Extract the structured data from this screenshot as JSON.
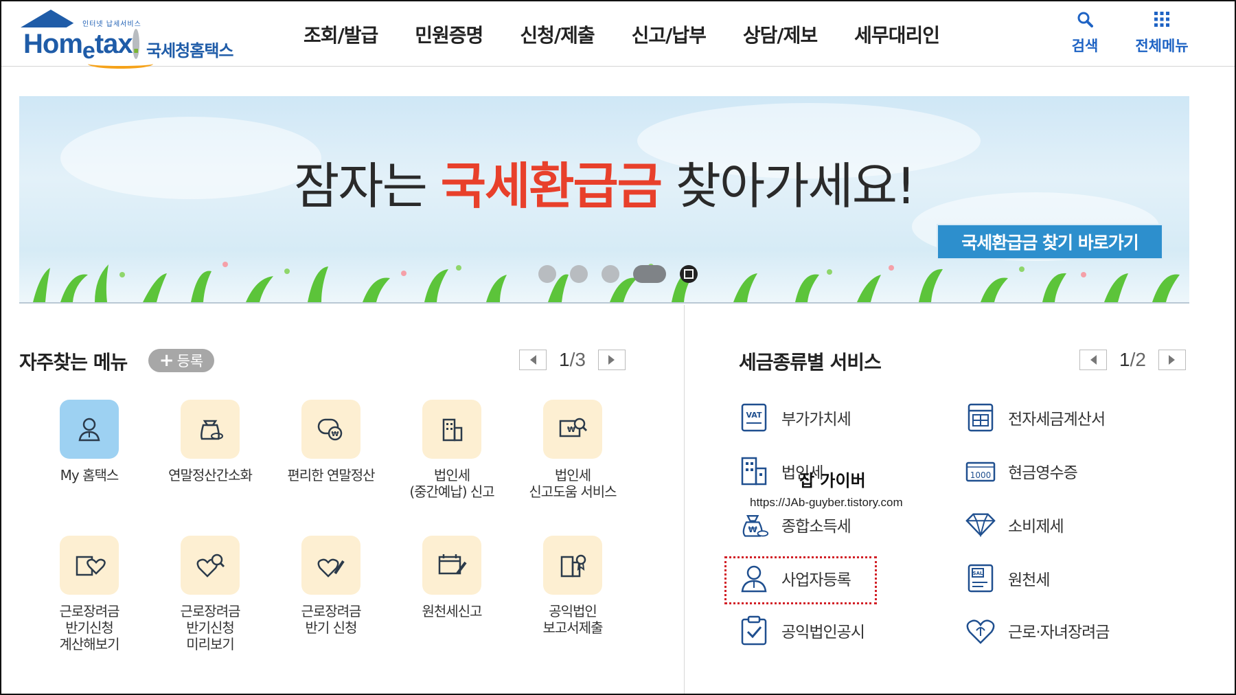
{
  "header": {
    "logo": {
      "sub": "인터넷 납세서비스",
      "main_pre": "Hom",
      "main_e": "e",
      "main_post": "tax",
      "dot": ".",
      "ko": "국세청홈택스"
    },
    "nav": [
      "조회/발급",
      "민원증명",
      "신청/제출",
      "신고/납부",
      "상담/제보",
      "세무대리인"
    ],
    "search_label": "검색",
    "menu_label": "전체메뉴"
  },
  "banner": {
    "title_pre": "잠자는 ",
    "title_accent": "국세환급금",
    "title_post": " 찾아가세요!",
    "button_label": "국세환급금 찾기 바로가기",
    "slide_count": 5,
    "active_slide": 4
  },
  "favorites": {
    "title": "자주찾는 메뉴",
    "register_label": "등록",
    "register_plus": "+",
    "page_current": "1",
    "page_sep": "/",
    "page_total": "3",
    "items": [
      {
        "label": "My 홈택스",
        "icon": "user-icon"
      },
      {
        "label": "연말정산간소화",
        "icon": "money-bag-icon"
      },
      {
        "label": "편리한 연말정산",
        "icon": "coin-bubble-icon"
      },
      {
        "label": "법인세\n(중간예납) 신고",
        "icon": "building-icon"
      },
      {
        "label": "법인세\n신고도움 서비스",
        "icon": "document-search-icon"
      },
      {
        "label": "근로장려금\n반기신청\n계산해보기",
        "icon": "heart-calculator-icon"
      },
      {
        "label": "근로장려금\n반기신청\n미리보기",
        "icon": "heart-search-icon"
      },
      {
        "label": "근로장려금\n반기 신청",
        "icon": "heart-pen-icon"
      },
      {
        "label": "원천세신고",
        "icon": "calendar-pen-icon"
      },
      {
        "label": "공익법인\n보고서제출",
        "icon": "building-ribbon-icon"
      }
    ]
  },
  "tax_services": {
    "title": "세금종류별 서비스",
    "page_current": "1",
    "page_sep": "/",
    "page_total": "2",
    "icon_vat_text": "VAT",
    "icon_cash_text": "1000",
    "icon_sal_text": "SAL",
    "items": [
      {
        "label": "부가가치세",
        "icon": "vat-icon"
      },
      {
        "label": "전자세금계산서",
        "icon": "invoice-icon"
      },
      {
        "label": "법인세",
        "icon": "building-icon"
      },
      {
        "label": "현금영수증",
        "icon": "cash-receipt-icon"
      },
      {
        "label": "종합소득세",
        "icon": "money-bag-icon"
      },
      {
        "label": "소비제세",
        "icon": "diamond-icon"
      },
      {
        "label": "사업자등록",
        "icon": "user-icon"
      },
      {
        "label": "원천세",
        "icon": "salary-doc-icon"
      },
      {
        "label": "공익법인공시",
        "icon": "clipboard-check-icon"
      },
      {
        "label": "근로·자녀장려금",
        "icon": "heart-icon"
      }
    ]
  },
  "watermark": {
    "name": "잡 가이버",
    "url": "https://JAb-guyber.tistory.com"
  },
  "colors": {
    "brand_blue": "#1f5ca8",
    "accent_red": "#e8402b",
    "banner_button": "#2d8fcd",
    "highlight": "#d21f26"
  }
}
